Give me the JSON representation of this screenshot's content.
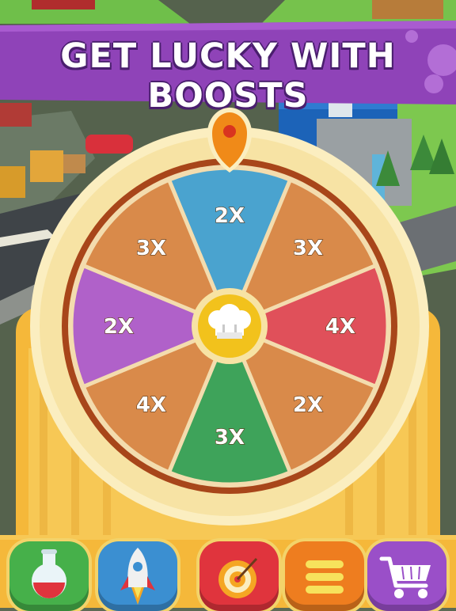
{
  "banner": {
    "title": "GET LUCKY WITH BOOSTS"
  },
  "wheel": {
    "center_icon": "chef-hat-icon",
    "pointer_icon": "map-pin-icon",
    "segments": [
      {
        "label": "2X",
        "color": "#4aa3cf"
      },
      {
        "label": "3X",
        "color": "#d98a4a"
      },
      {
        "label": "4X",
        "color": "#e0505a"
      },
      {
        "label": "2X",
        "color": "#d98a4a"
      },
      {
        "label": "3X",
        "color": "#3ea35a"
      },
      {
        "label": "4X",
        "color": "#d98a4a"
      },
      {
        "label": "2X",
        "color": "#b061c9"
      },
      {
        "label": "3X",
        "color": "#d98a4a"
      }
    ]
  },
  "toolbar": {
    "buttons": [
      {
        "icon": "potion-flask-icon",
        "color": "#46b04a"
      },
      {
        "icon": "rocket-icon",
        "color": "#3b8fd1"
      },
      {
        "icon": "target-dart-icon",
        "color": "#e0343d"
      },
      {
        "icon": "menu-icon",
        "color": "#ee7d1f"
      },
      {
        "icon": "shopping-cart-icon",
        "color": "#9a4fc8"
      }
    ]
  }
}
